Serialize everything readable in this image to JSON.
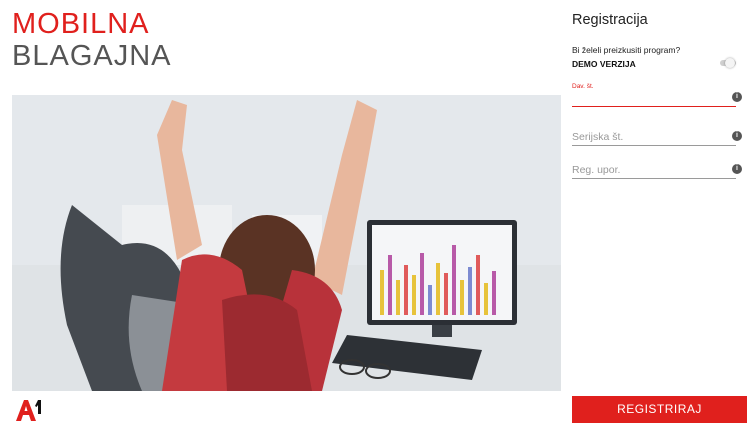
{
  "brand": {
    "line1": "MOBILNA",
    "line2": "BLAGAJNA"
  },
  "colors": {
    "accent": "#e0201d"
  },
  "hero": {
    "icon": "celebrating-office-worker-photo"
  },
  "logo": {
    "text": "A1",
    "icon": "a1-logo"
  },
  "registration": {
    "title": "Registracija",
    "demo_question": "Bi želeli preizkusiti program?",
    "demo_label": "DEMO VERZIJA",
    "demo_enabled": false,
    "fields": [
      {
        "label": "Dav. št.",
        "value": "",
        "placeholder": ""
      },
      {
        "label": "",
        "value": "",
        "placeholder": "Serijska št."
      },
      {
        "label": "",
        "value": "",
        "placeholder": "Reg. upor."
      }
    ],
    "info_icon": "i",
    "submit_label": "REGISTRIRAJ"
  }
}
